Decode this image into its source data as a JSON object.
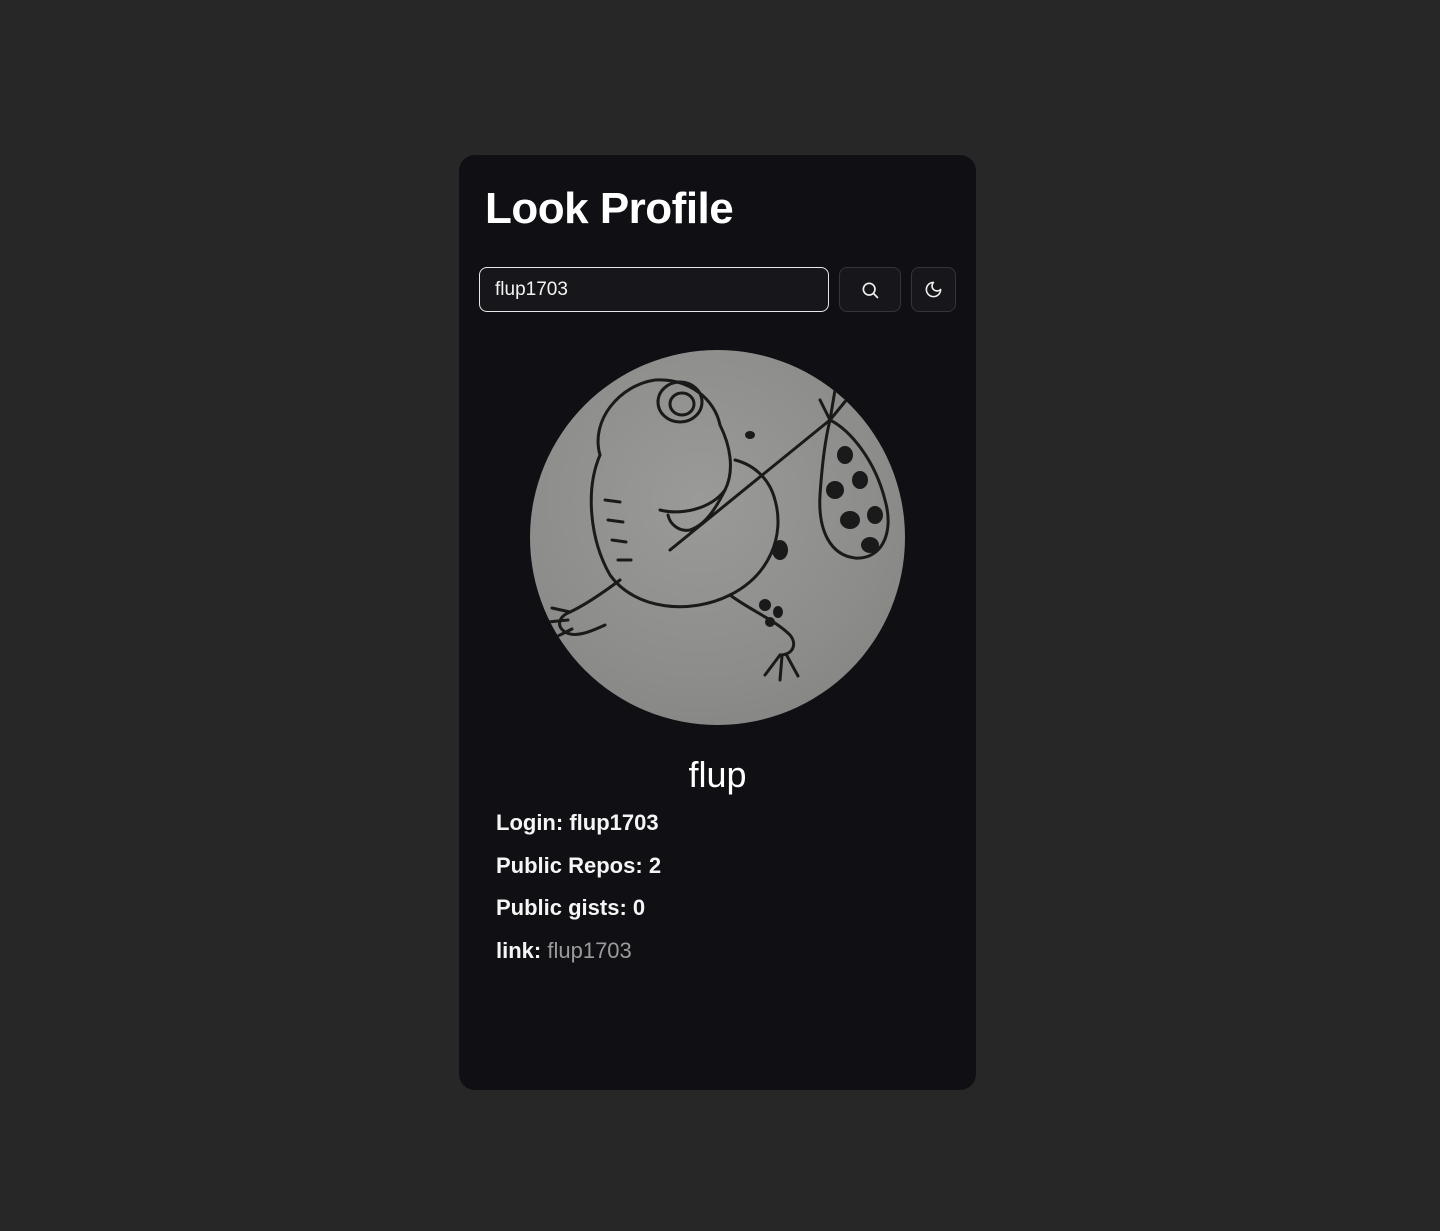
{
  "header": {
    "title": "Look Profile"
  },
  "search": {
    "value": "flup1703"
  },
  "profile": {
    "name": "flup",
    "login_label": "Login:",
    "login": "flup1703",
    "repos_label": "Public Repos:",
    "repos": "2",
    "gists_label": "Public gists:",
    "gists": "0",
    "link_label": "link:",
    "link_text": "flup1703"
  },
  "icons": {
    "search": "search-icon",
    "theme": "moon-icon",
    "avatar": "frog-drawing"
  },
  "colors": {
    "page_background": "#272727",
    "card_background": "#101014",
    "link": "#9a9a9a"
  }
}
